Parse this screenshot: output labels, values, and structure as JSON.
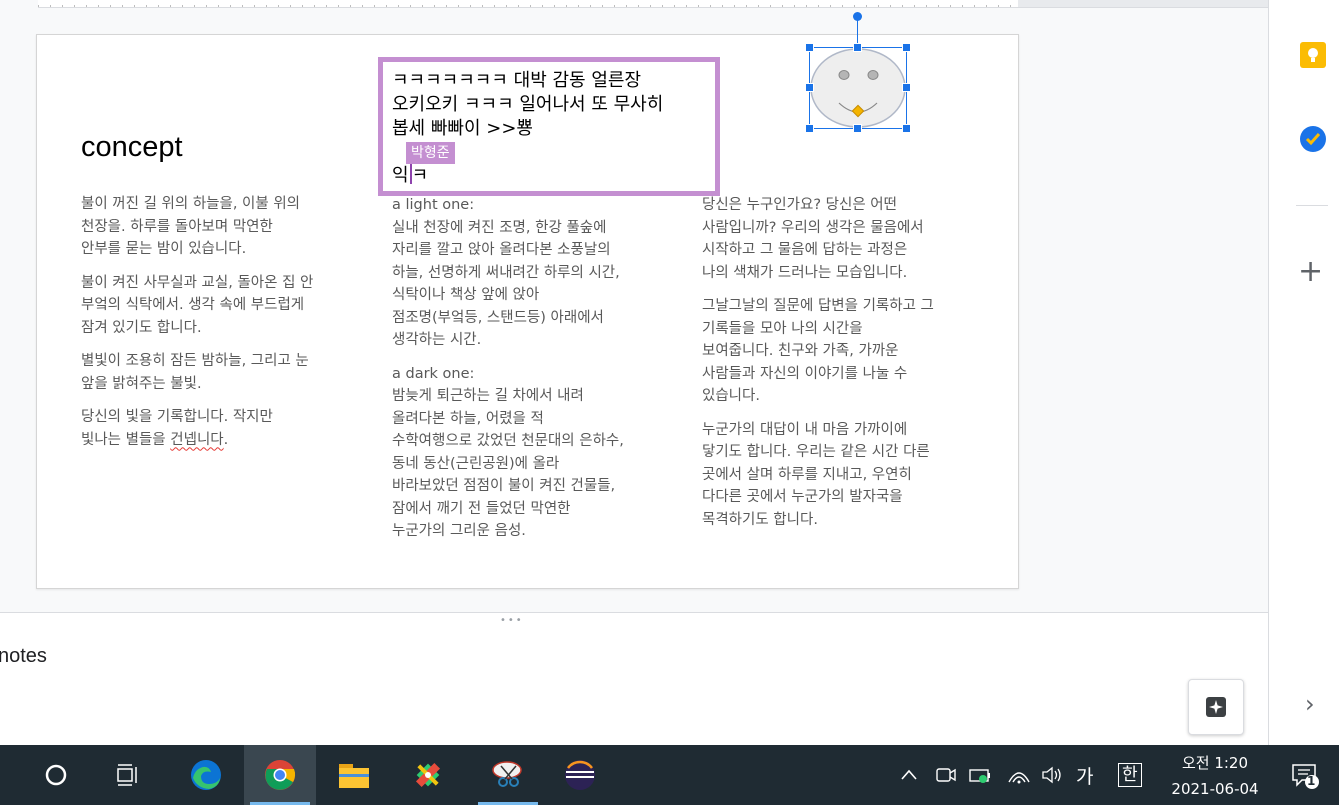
{
  "slide": {
    "title": "concept",
    "col1": [
      "불이 꺼진 길 위의 하늘을, 이불 위의\n천장을. 하루를 돌아보며 막연한\n안부를 묻는 밤이 있습니다.",
      "불이 켜진 사무실과 교실, 돌아온 집 안\n부엌의 식탁에서. 생각 속에 부드럽게\n잠겨 있기도 합니다.",
      "별빛이 조용히 잠든 밤하늘, 그리고 눈\n앞을 밝혀주는 불빛."
    ],
    "col1_last_a": "당신의 빛을 기록합니다. 작지만\n빛나는 별들을 ",
    "col1_last_spell": "건넵니다",
    "col1_last_b": ".",
    "col2": [
      "a light one:\n실내 천장에 켜진 조명, 한강 풀숲에\n자리를 깔고 앉아 올려다본 소풍날의\n하늘, 선명하게 써내려간 하루의 시간,\n식탁이나 책상 앞에 앉아\n점조명(부엌등, 스탠드등) 아래에서\n생각하는 시간.",
      "a dark one:\n밤늦게 퇴근하는 길 차에서 내려\n올려다본 하늘, 어렸을 적\n수학여행으로 갔었던 천문대의 은하수,\n동네 동산(근린공원)에 올라\n바라보았던 점점이 불이 켜진 건물들,\n잠에서 깨기 전 들었던 막연한\n누군가의 그리운 음성."
    ],
    "col3": [
      "당신은 누구인가요? 당신은 어떤\n사람입니까? 우리의 생각은 물음에서\n시작하고 그 물음에 답하는 과정은\n나의 색채가 드러나는 모습입니다.",
      "그날그날의 질문에 답변을 기록하고 그\n기록들을 모아 나의 시간을\n보여줍니다. 친구와 가족, 가까운\n사람들과 자신의 이야기를 나눌 수\n있습니다.",
      "누군가의 대답이 내 마음 가까이에\n닿기도 합니다. 우리는 같은 시간 다른\n곳에서 살며 하루를 지내고, 우연히\n다다른 곳에서 누군가의 발자국을\n목격하기도 합니다."
    ],
    "textbox": {
      "text": "ㅋㅋㅋㅋㅋㅋㅋ 대박 감동 얼른장\n오키오키 ㅋㅋㅋ 일어나서 또 무사히\n봅세 빠빠이 >>뿅",
      "line2_a": "익",
      "line2_b": "ㅋ",
      "collaborator": "박형준",
      "border_color": "#c48fd1"
    }
  },
  "notes": {
    "label": "notes"
  },
  "taskbar": {
    "ime_lang": "가",
    "ime_mode": "한",
    "clock_time": "오전 1:20",
    "clock_date": "2021-06-04",
    "notification_count": "1"
  },
  "colors": {
    "accent": "#1a73e8",
    "taskbar": "#1f2b33",
    "keep_yellow": "#fbbc04"
  }
}
